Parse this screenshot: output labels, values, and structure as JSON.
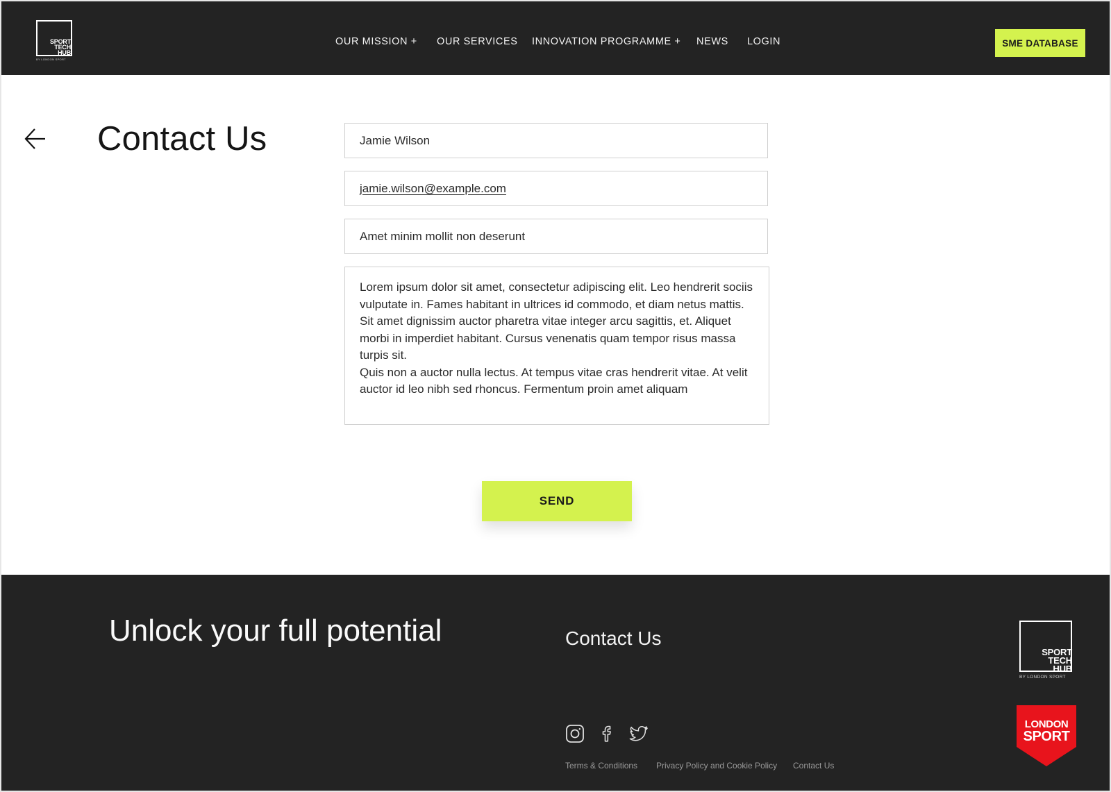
{
  "brand": {
    "logo_lines": [
      "SPORT",
      "TECH",
      "HUB"
    ],
    "logo_sub": "BY LONDON SPORT",
    "badge_lines": [
      "LONDON",
      "SPORT"
    ],
    "accent_color": "#d4f24e",
    "header_bg": "#232323",
    "badge_color": "#e8141c"
  },
  "nav": {
    "items": [
      {
        "label": "OUR MISSION  +"
      },
      {
        "label": "OUR SERVICES"
      },
      {
        "label": "INNOVATION PROGRAMME +"
      },
      {
        "label": "NEWS"
      },
      {
        "label": "LOGIN"
      }
    ],
    "cta_label": "SME DATABASE"
  },
  "page": {
    "back_icon": "arrow-left-icon",
    "title": "Contact Us"
  },
  "form": {
    "name_value": "Jamie Wilson",
    "email_value": "jamie.wilson@example.com",
    "subject_value": "Amet minim mollit non deserunt",
    "message_value": "Lorem ipsum dolor sit amet, consectetur adipiscing elit. Leo hendrerit sociis vulputate in. Fames habitant in ultrices id commodo, et diam netus mattis. Sit amet dignissim auctor pharetra vitae integer arcu sagittis, et. Aliquet morbi in imperdiet habitant. Cursus venenatis quam tempor risus massa turpis sit.\nQuis non a auctor nulla lectus. At tempus vitae cras hendrerit vitae. At velit auctor id leo nibh sed rhoncus. Fermentum proin amet aliquam",
    "send_label": "SEND"
  },
  "footer": {
    "tagline": "Unlock your full potential",
    "contact_heading": "Contact Us",
    "social_icons": [
      "instagram-icon",
      "facebook-icon",
      "twitter-icon"
    ],
    "links": [
      {
        "label": "Terms & Conditions"
      },
      {
        "label": "Privacy Policy and Cookie Policy"
      },
      {
        "label": "Contact Us"
      }
    ]
  }
}
